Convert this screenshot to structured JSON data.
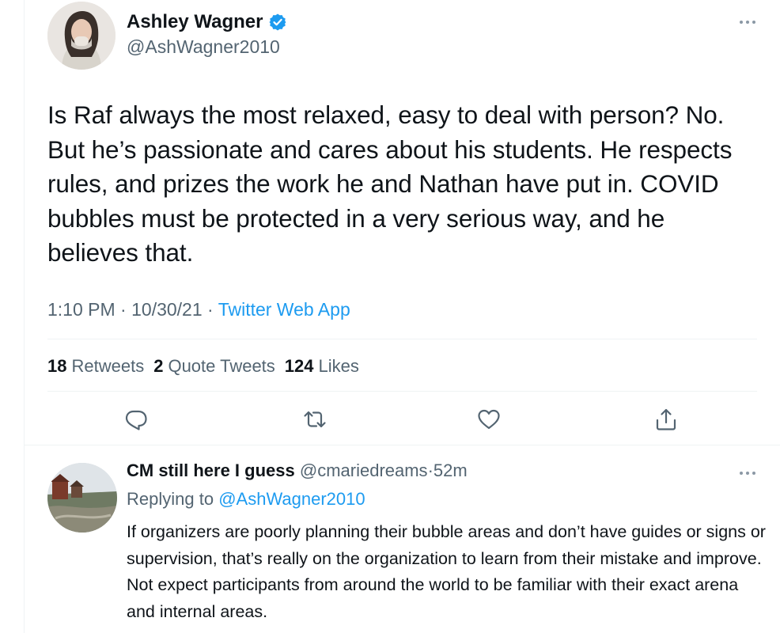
{
  "tweet": {
    "author": {
      "name": "Ashley Wagner",
      "handle": "@AshWagner2010",
      "verified": true
    },
    "text": "Is Raf always the most relaxed, easy to deal with person? No. But he’s passionate and cares about his students. He respects rules, and prizes the work he and Nathan have put in. COVID bubbles must be protected in a very serious way, and he believes that.",
    "time": "1:10 PM",
    "date": "10/30/21",
    "separator": "·",
    "source": "Twitter Web App",
    "stats": {
      "retweets_count": "18",
      "retweets_label": "Retweets",
      "quotes_count": "2",
      "quotes_label": "Quote Tweets",
      "likes_count": "124",
      "likes_label": "Likes"
    },
    "actions": [
      "reply-icon",
      "retweet-icon",
      "like-icon",
      "share-icon"
    ]
  },
  "reply": {
    "author": {
      "name": "CM still here I guess",
      "handle": "@cmariedreams"
    },
    "separator": "·",
    "time_ago": "52m",
    "replying_prefix": "Replying to",
    "replying_to": "@AshWagner2010",
    "text": "If organizers are poorly planning their bubble areas and don’t have guides or signs or supervision, that’s really on the organization to learn from their mistake and improve. Not expect participants from around the world to be familiar with their exact arena and internal areas."
  },
  "colors": {
    "text_primary": "#0f1419",
    "text_secondary": "#536471",
    "accent": "#1d9bf0",
    "divider": "#eff3f4"
  }
}
